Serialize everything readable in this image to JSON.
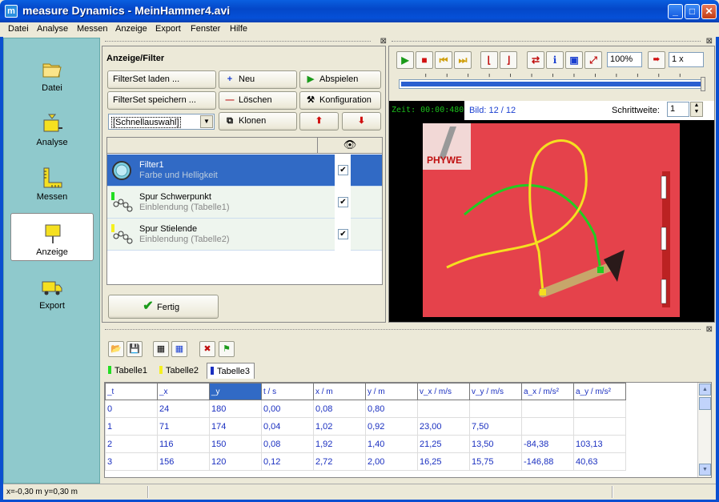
{
  "window": {
    "title": "measure Dynamics - MeinHammer4.avi",
    "app_icon": "m",
    "minimize": "_",
    "maximize": "□",
    "close": "✕"
  },
  "menu": [
    "Datei",
    "Analyse",
    "Messen",
    "Anzeige",
    "Export",
    "Fenster",
    "Hilfe"
  ],
  "nav": {
    "items": [
      {
        "label": "Datei",
        "icon": "folder-icon"
      },
      {
        "label": "Analyse",
        "icon": "analyse-icon"
      },
      {
        "label": "Messen",
        "icon": "ruler-icon"
      },
      {
        "label": "Anzeige",
        "icon": "sign-icon",
        "active": true
      },
      {
        "label": "Export",
        "icon": "truck-icon"
      }
    ]
  },
  "filter_panel": {
    "title": "Anzeige/Filter",
    "buttons": {
      "load": "FilterSet laden ...",
      "save": "FilterSet speichern ...",
      "new": "Neu",
      "delete": "Löschen",
      "clone": "Klonen",
      "play": "Abspielen",
      "config": "Konfiguration",
      "done": "Fertig"
    },
    "quick_select": "[Schnellauswahl]",
    "visibility_header_icon": "👁",
    "filters": [
      {
        "name": "Filter1",
        "description": "Farbe und Helligkeit",
        "checked": true,
        "selected": true
      },
      {
        "name": "Spur Schwerpunkt",
        "description": "Einblendung (Tabelle1)",
        "checked": true,
        "selected": false
      },
      {
        "name": "Spur Stielende",
        "description": "Einblendung (Tabelle2)",
        "checked": true,
        "selected": false
      }
    ],
    "check_mark": "✔"
  },
  "video": {
    "zoom": "100%",
    "speed": "1 x",
    "zeit": "Zeit:  00:00:480",
    "bild": "Bild: 12 / 12",
    "schritt_label": "Schrittweite:",
    "schritt_value": "1",
    "timeline_progress": 1.0,
    "logo_text": "PHYWE",
    "colors": {
      "track_green": "#22cc22",
      "track_yellow": "#f5e020",
      "background": "#e8404a"
    }
  },
  "table_panel": {
    "tabs": [
      {
        "label": "Tabelle1",
        "color": "#22dd22"
      },
      {
        "label": "Tabelle2",
        "color": "#f5f020"
      },
      {
        "label": "Tabelle3",
        "color": "#1a2fc0",
        "active": true
      }
    ],
    "columns": [
      "_t",
      "_x",
      "_y",
      "t / s",
      "x / m",
      "y / m",
      "v_x / m/s",
      "v_y / m/s",
      "a_x / m/s²",
      "a_y / m/s²"
    ],
    "highlighted_column": 2,
    "rows": [
      [
        "0",
        "24",
        "180",
        "0,00",
        "0,08",
        "0,80",
        "",
        "",
        "",
        ""
      ],
      [
        "1",
        "71",
        "174",
        "0,04",
        "1,02",
        "0,92",
        "23,00",
        "7,50",
        "",
        ""
      ],
      [
        "2",
        "116",
        "150",
        "0,08",
        "1,92",
        "1,40",
        "21,25",
        "13,50",
        "-84,38",
        "103,13"
      ],
      [
        "3",
        "156",
        "120",
        "0,12",
        "2,72",
        "2,00",
        "16,25",
        "15,75",
        "-146,88",
        "40,63"
      ]
    ]
  },
  "status": {
    "coords": "x=-0,30 m  y=0,30 m"
  }
}
